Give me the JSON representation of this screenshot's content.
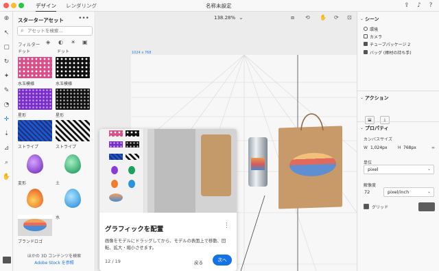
{
  "app": {
    "title": "名称未設定"
  },
  "tabs": [
    "デザイン",
    "レンダリング"
  ],
  "assets": {
    "title": "スターターアセット",
    "search_placeholder": "アセットを検索...",
    "filter_label": "フィルター",
    "top_labels": [
      "ドット",
      "ドット"
    ],
    "items": [
      {
        "label": "水玉模様",
        "style": "polka"
      },
      {
        "label": "水玉模様",
        "style": "polka2"
      },
      {
        "label": "星形",
        "style": "star1"
      },
      {
        "label": "星形",
        "style": "star2"
      },
      {
        "label": "ストライプ",
        "style": "stripe1"
      },
      {
        "label": "ストライプ",
        "style": "stripe2"
      },
      {
        "label": "変形",
        "style": "purple"
      },
      {
        "label": "土",
        "style": "green"
      },
      {
        "label": "火",
        "style": "fire"
      },
      {
        "label": "水",
        "style": "water"
      },
      {
        "label": "ブランドロゴ",
        "style": "logo"
      }
    ],
    "bottom_text": "ほかの 3D コンテンツを検索",
    "bottom_link": "Adobe Stock を参照"
  },
  "canvas": {
    "zoom": "138.28%",
    "artboard_label": "1024 x 768"
  },
  "popup": {
    "title": "グラフィックを配置",
    "body": "画像をモデルにドラッグしてから、モデルの表面上で移動、回転、拡大・縮小させます。",
    "count": "12 / 19",
    "back": "戻る",
    "next": "次へ"
  },
  "right": {
    "scene_title": "シーン",
    "scene_items": [
      "環境",
      "カメラ",
      "チューブパッケージ 2",
      "バッグ (棒材の持ち手)"
    ],
    "action_title": "アクション",
    "props_title": "プロパティ",
    "canvas_size": "カンバスサイズ",
    "w_label": "W",
    "w_value": "1,024px",
    "h_label": "H",
    "h_value": "768px",
    "unit_label": "単位",
    "unit_value": "pixel",
    "res_label": "解像度",
    "res_value": "72",
    "res_unit": "pixel/inch",
    "grid_label": "グリッド"
  },
  "colors": {
    "accent": "#1473e6",
    "grid_swatch": "#5d5d5d"
  }
}
